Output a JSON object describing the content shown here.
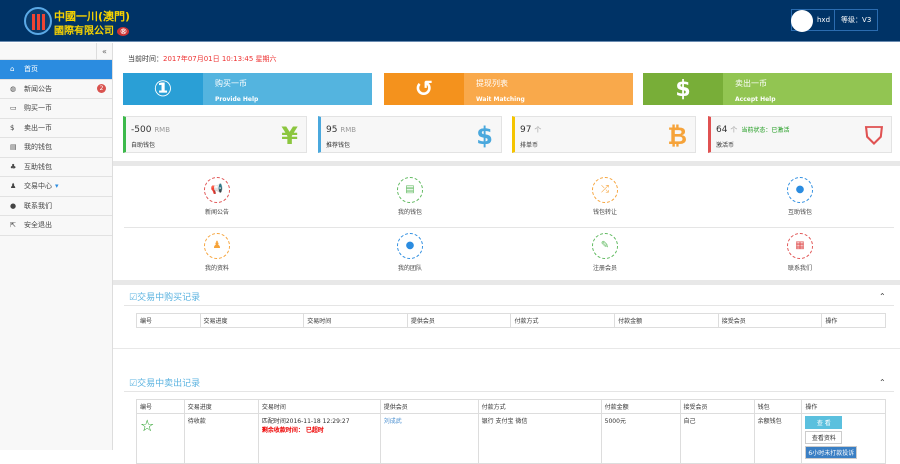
{
  "header": {
    "brand_line1": "中國一川(澳門)",
    "brand_line2": "國際有限公司",
    "brand_badge": "®",
    "username": "hxd",
    "level": "等级：V3"
  },
  "sidebar": {
    "collapse": "«",
    "items": [
      {
        "label": "首页",
        "icon": "home-icon"
      },
      {
        "label": "新闻公告",
        "icon": "globe-icon",
        "badge": "2"
      },
      {
        "label": "购买一币",
        "icon": "money-icon"
      },
      {
        "label": "卖出一币",
        "icon": "dollar-icon"
      },
      {
        "label": "我的钱包",
        "icon": "wallet-icon"
      },
      {
        "label": "互助钱包",
        "icon": "group-icon"
      },
      {
        "label": "交易中心",
        "icon": "user-icon",
        "caret": "▾"
      },
      {
        "label": "联系我们",
        "icon": "chat-icon"
      },
      {
        "label": "安全退出",
        "icon": "logout-icon"
      }
    ]
  },
  "time": {
    "label": "当前时间：",
    "value": "2017年07月01日 10:13:45 星期六"
  },
  "actions": [
    {
      "title": "购买一币",
      "sub": "Provide Help",
      "glyph": "①",
      "color": "#54b4df",
      "dark": "#2a9fd6"
    },
    {
      "title": "提现列表",
      "sub": "Wait Matching",
      "glyph": "↺",
      "color": "#f9a94b",
      "dark": "#f4921d"
    },
    {
      "title": "卖出一币",
      "sub": "Accept Help",
      "glyph": "$",
      "color": "#92c552",
      "dark": "#78ae38"
    }
  ],
  "stats": [
    {
      "value": "-500",
      "unit": "RMB",
      "name": "自助钱包",
      "glyph": "¥",
      "color": "#8cc63f",
      "border": "#3cb94b"
    },
    {
      "value": "95",
      "unit": "RMB",
      "name": "推荐钱包",
      "glyph": "$",
      "color": "#4aa8dd",
      "border": "#4aa8dd"
    },
    {
      "value": "97",
      "unit": "个",
      "name": "排单币",
      "glyph": "₿",
      "color": "#f6a33a",
      "border": "#f5c400"
    },
    {
      "value": "64",
      "unit": "个",
      "status": "当前状态：已激活",
      "name": "激活币",
      "glyph": "⛉",
      "color": "#e05252",
      "border": "#e05252"
    }
  ],
  "grid": [
    {
      "label": "新闻公告",
      "glyph": "📢",
      "color": "#e05252"
    },
    {
      "label": "我的钱包",
      "glyph": "▤",
      "color": "#5cb85c"
    },
    {
      "label": "钱包转让",
      "glyph": "⤮",
      "color": "#f6a33a"
    },
    {
      "label": "互助钱包",
      "glyph": "●",
      "color": "#2b8ce0"
    },
    {
      "label": "我的资料",
      "glyph": "♟",
      "color": "#f6a33a"
    },
    {
      "label": "我的团队",
      "glyph": "●",
      "color": "#2b8ce0"
    },
    {
      "label": "注册会员",
      "glyph": "✎",
      "color": "#5cb85c"
    },
    {
      "label": "联系我们",
      "glyph": "▦",
      "color": "#e05252"
    }
  ],
  "buy_panel": {
    "title": "交易中购买记录",
    "columns": [
      "编号",
      "交易进度",
      "交易时间",
      "提供会员",
      "付款方式",
      "付款金额",
      "接受会员",
      "操作"
    ]
  },
  "sell_panel": {
    "title": "交易中卖出记录",
    "columns": [
      "编号",
      "交易进度",
      "交易时间",
      "提供会员",
      "付款方式",
      "付款金额",
      "接受会员",
      "钱包",
      "操作"
    ],
    "rows": [
      {
        "progress": "待收款",
        "time": "匹配时间2016-11-18 12:29:27",
        "remaining": "剩余收款时间： 已超时",
        "provider": "刘成武",
        "payment": "银行 支付宝 微信",
        "amount": "5000元",
        "receiver": "自己",
        "wallet": "余额钱包",
        "buttons": [
          "查 看",
          "查看资料",
          "6小时未打款投诉"
        ]
      }
    ]
  },
  "caret": "⌃"
}
